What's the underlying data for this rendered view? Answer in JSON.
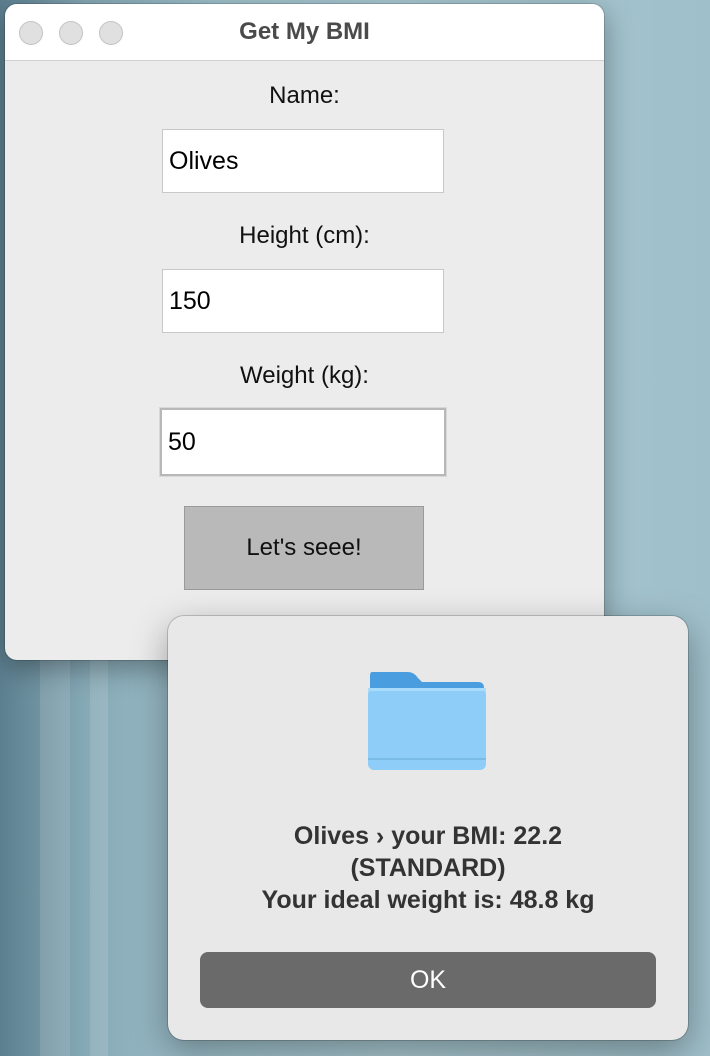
{
  "window": {
    "title": "Get My BMI"
  },
  "form": {
    "name_label": "Name:",
    "name_value": "Olives",
    "height_label": "Height (cm):",
    "height_value": "150",
    "weight_label": "Weight (kg):",
    "weight_value": "50",
    "submit_label": "Let's seee!"
  },
  "alert": {
    "icon": "folder-icon",
    "line1": "Olives › your BMI: 22.2",
    "line2": "(STANDARD)",
    "line3": "Your ideal weight is:  48.8 kg",
    "ok_label": "OK"
  },
  "colors": {
    "folder_top": "#4a9ee0",
    "folder_front": "#8dcdf8",
    "ok_button": "#6a6a6a"
  }
}
